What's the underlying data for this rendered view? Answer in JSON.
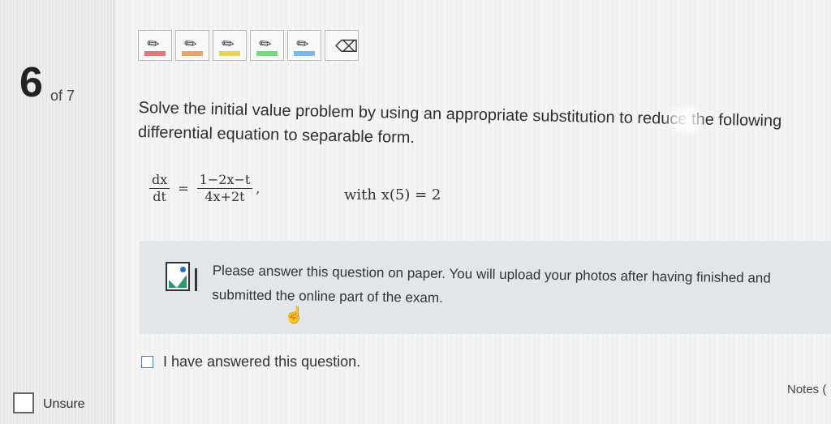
{
  "question": {
    "number": "6",
    "of_label": "of 7",
    "prompt": "Solve the initial value problem by using an appropriate substitution to reduce the following differential equation to separable form.",
    "equation": {
      "lhs_num": "dx",
      "lhs_den": "dt",
      "equals": "=",
      "rhs_num": "1−2x−t",
      "rhs_den": "4x+2t",
      "comma": ",",
      "condition": "with x(5) = 2"
    }
  },
  "toolbar": {
    "tools": [
      {
        "name": "highlighter-red",
        "color": "#e07a7a"
      },
      {
        "name": "highlighter-orange",
        "color": "#e8a66a"
      },
      {
        "name": "highlighter-yellow",
        "color": "#e8d45a"
      },
      {
        "name": "highlighter-green",
        "color": "#7ed67e"
      },
      {
        "name": "highlighter-blue",
        "color": "#7fb6e8"
      },
      {
        "name": "eraser",
        "color": "#333333"
      }
    ]
  },
  "notice": {
    "text": "Please answer this question on paper. You will upload your photos after having finished and submitted the online part of the exam."
  },
  "answered_checkbox": {
    "label": "I have answered this question."
  },
  "sidebar": {
    "unsure_label": "Unsure"
  },
  "footer": {
    "notes_label": "Notes ("
  }
}
